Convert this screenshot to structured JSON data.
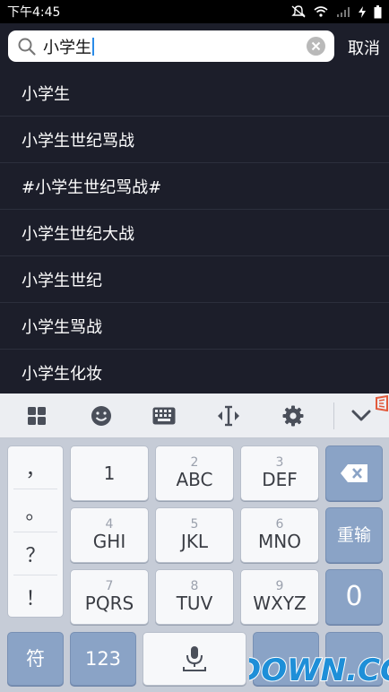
{
  "status_bar": {
    "time": "下午4:45"
  },
  "search": {
    "query": "小学生",
    "cancel_label": "取消"
  },
  "suggestions": [
    "小学生",
    "小学生世纪骂战",
    "#小学生世纪骂战#",
    "小学生世纪大战",
    "小学生世纪",
    "小学生骂战",
    "小学生化妆"
  ],
  "keyboard": {
    "toolbar_icons": [
      "grid-icon",
      "emoji-icon",
      "keyboard-icon",
      "cursor-move-icon",
      "gear-icon",
      "collapse-chevron-icon"
    ],
    "punctuation": [
      "，",
      "。",
      "？",
      "！"
    ],
    "keys": [
      {
        "num": "",
        "letters": "1"
      },
      {
        "num": "2",
        "letters": "ABC"
      },
      {
        "num": "3",
        "letters": "DEF"
      },
      {
        "num": "4",
        "letters": "GHI"
      },
      {
        "num": "5",
        "letters": "JKL"
      },
      {
        "num": "6",
        "letters": "MNO"
      },
      {
        "num": "7",
        "letters": "PQRS"
      },
      {
        "num": "8",
        "letters": "TUV"
      },
      {
        "num": "9",
        "letters": "WXYZ"
      }
    ],
    "right_keys": {
      "enter": "重输",
      "zero": "0"
    },
    "bottom": {
      "symbols": "符",
      "numbers": "123"
    }
  },
  "watermark": {
    "text": "DOWN.CC",
    "brand_color": "#1e8fd8"
  }
}
